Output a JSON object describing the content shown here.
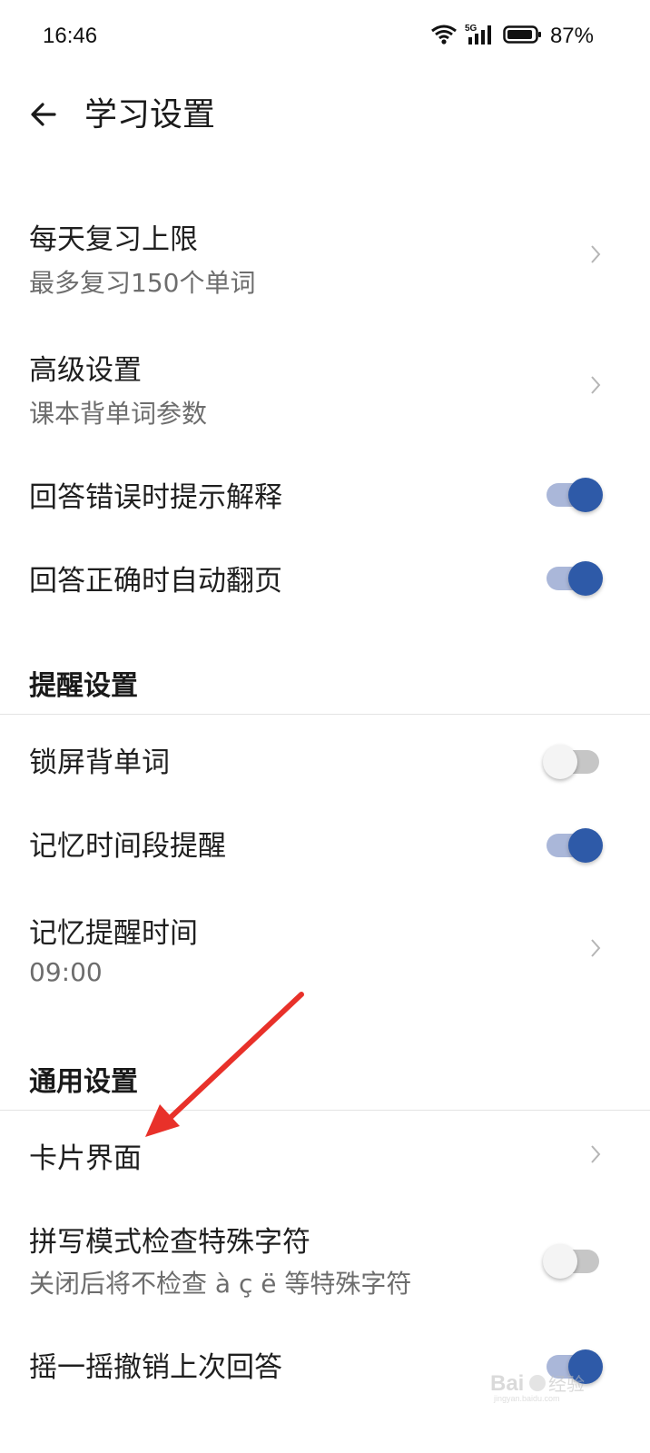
{
  "status_bar": {
    "time": "16:46",
    "network": "5G",
    "battery": "87%"
  },
  "header": {
    "title": "学习设置"
  },
  "items": {
    "review_limit": {
      "title": "每天复习上限",
      "subtitle": "最多复习150个单词"
    },
    "advanced": {
      "title": "高级设置",
      "subtitle": "课本背单词参数"
    },
    "explain_on_wrong": {
      "title": "回答错误时提示解释",
      "checked": true
    },
    "auto_flip": {
      "title": "回答正确时自动翻页",
      "checked": true
    }
  },
  "reminder_section": {
    "header": "提醒设置",
    "lockscreen": {
      "title": "锁屏背单词",
      "checked": false
    },
    "memory_reminder": {
      "title": "记忆时间段提醒",
      "checked": true
    },
    "reminder_time": {
      "title": "记忆提醒时间",
      "value": "09:00"
    }
  },
  "general_section": {
    "header": "通用设置",
    "card_ui": {
      "title": "卡片界面"
    },
    "spelling_check": {
      "title": "拼写模式检查特殊字符",
      "subtitle": "关闭后将不检查 à ç ë 等特殊字符",
      "checked": false
    },
    "shake_undo": {
      "title": "摇一摇撤销上次回答",
      "checked": true
    }
  },
  "colors": {
    "accent": "#2e5aa8",
    "track_on": "#aab7d9",
    "annotation": "#e8312a"
  }
}
